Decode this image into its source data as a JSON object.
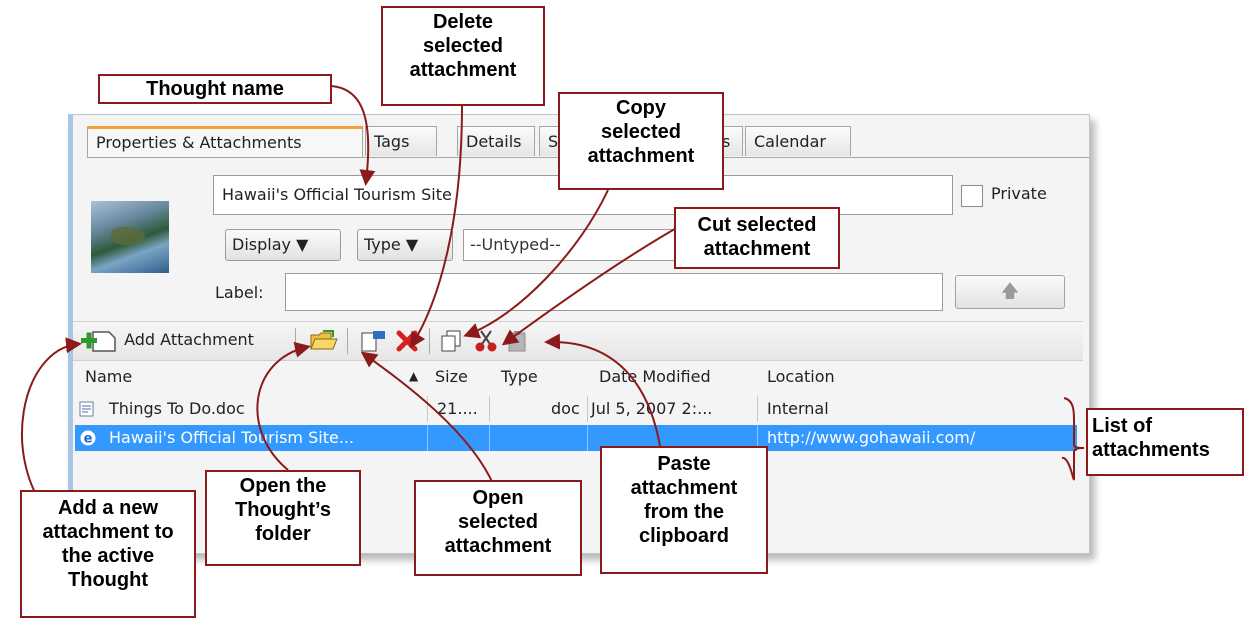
{
  "tabs": [
    "Properties & Attachments",
    "Tags",
    "Details",
    "S",
    "s",
    "Calendar"
  ],
  "thought_name_value": "Hawaii's Official Tourism Site",
  "private_label": "Private",
  "display_label": "Display ▼",
  "type_label": "Type ▼",
  "untyped_value": "--Untyped--",
  "label_text": "Label:",
  "label_value": "",
  "toolbar": {
    "add_attachment": "Add Attachment"
  },
  "list": {
    "columns": [
      "Name",
      "Size",
      "Type",
      "Date Modified",
      "Location"
    ],
    "rows": [
      {
        "name": "Things To Do.doc",
        "size": "21....",
        "type": "doc",
        "date": "Jul 5, 2007 2:...",
        "location": "Internal"
      },
      {
        "name": "Hawaii's Official Tourism Site...",
        "size": "",
        "type": "",
        "date": "",
        "location": "http://www.gohawaii.com/"
      }
    ]
  },
  "callouts": {
    "thought_name": "Thought name",
    "delete": "Delete\nselected\nattachment",
    "copy": "Copy\nselected\nattachment",
    "cut": "Cut selected\nattachment",
    "list": "List of\nattachments",
    "add": "Add a new\nattachment to\nthe active\nThought",
    "open_folder": "Open the\nThought’s\nfolder",
    "open_selected": "Open\nselected\nattachment",
    "paste": "Paste\nattachment\nfrom the\nclipboard"
  },
  "colors": {
    "callout_border": "#8b1a1a",
    "selection": "#3399ff",
    "active_tab_accent": "#f1a23a"
  }
}
